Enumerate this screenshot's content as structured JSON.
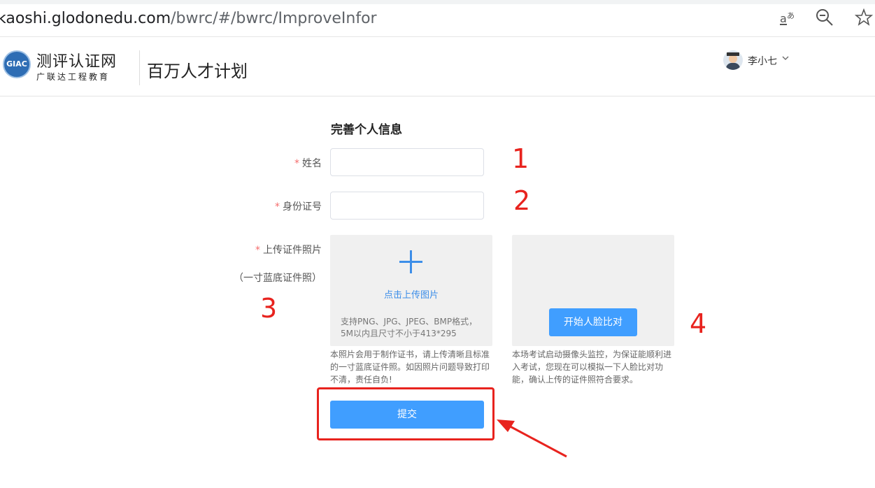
{
  "browser": {
    "url_host": "kaoshi.glodonedu.com",
    "url_path": "/bwrc/#/bwrc/ImproveInfor"
  },
  "header": {
    "logo_mark": "GIAC",
    "logo_title": "测评认证网",
    "logo_subtitle": "广联达工程教育",
    "site_name": "百万人才计划",
    "username": "李小七"
  },
  "form": {
    "title": "完善个人信息",
    "required_mark": "*",
    "name_label": "姓名",
    "id_label": "身份证号",
    "photo_label": "上传证件照片",
    "photo_sublabel": "（一寸蓝底证件照）",
    "upload_text": "点击上传图片",
    "upload_hint": "支持PNG、JPG、JPEG、BMP格式，5M以内且尺寸不小于413*295",
    "photo_note": "本照片会用于制作证书，请上传清晰且标准的一寸蓝底证件照。如因照片问题导致打印不清，责任自负!",
    "face_button": "开始人脸比对",
    "face_note": "本场考试启动摄像头监控，为保证能顺利进入考试，您现在可以模拟一下人脸比对功能，确认上传的证件照符合要求。",
    "submit_label": "提交"
  },
  "annotations": {
    "n1": "1",
    "n2": "2",
    "n3": "3",
    "n4": "4",
    "color": "#e8231e"
  },
  "colors": {
    "primary": "#409eff",
    "upload_accent": "#3d8ee8",
    "required": "#f56c6c"
  }
}
